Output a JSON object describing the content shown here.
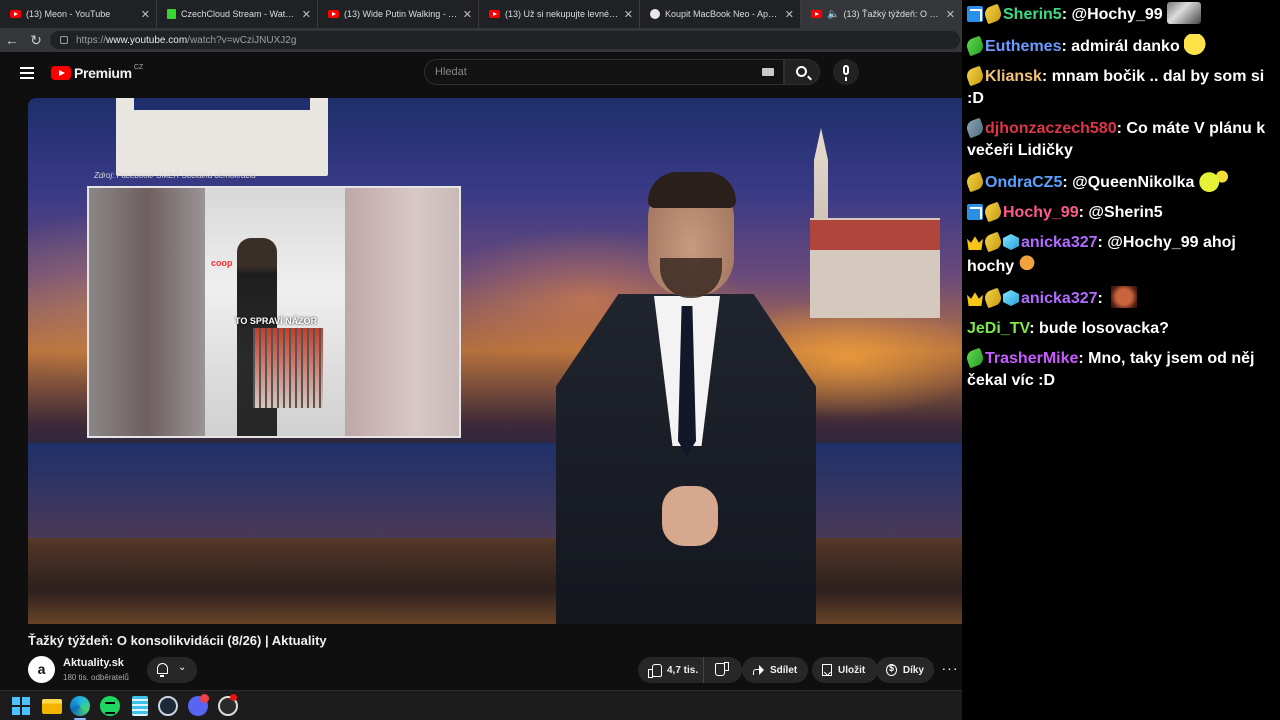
{
  "browser": {
    "tabs": [
      {
        "title": "(13) Meon - YouTube",
        "icon": "youtube-icon",
        "active": false
      },
      {
        "title": "CzechCloud Stream - Watch Live o",
        "icon": "kick-icon",
        "active": false
      },
      {
        "title": "(13) Wide Putin Walking - YouTube",
        "icon": "youtube-icon",
        "active": false
      },
      {
        "title": "(13) Už si nekupujte levné Window",
        "icon": "youtube-icon",
        "active": false
      },
      {
        "title": "Koupit MacBook Neo - Apple (CZ)",
        "icon": "apple-icon",
        "active": false
      },
      {
        "title": "(13) Ťažký týždeň: O konsolik",
        "icon": "youtube-icon",
        "active": true
      }
    ],
    "url_prefix": "https://",
    "url_host": "www.youtube.com",
    "url_path": "/watch?v=wCziJNUXJ2g"
  },
  "youtube": {
    "logo_text": "Premium",
    "country_code": "CZ",
    "search_placeholder": "Hledat"
  },
  "video": {
    "inset_source": "Zdroj: Facebook/ SMER Sociálna demokracia",
    "inset_store": "coop",
    "inset_caption": "TO SPRAVÍ NÁZOR",
    "title": "Ťažký týždeň: O konsolikvidácii (8/26) | Aktuality",
    "channel_avatar": "a",
    "channel_name": "Aktuality.sk",
    "channel_subs": "180 tis. odběratelů",
    "like_count": "4,7 tis.",
    "share_label": "Sdílet",
    "save_label": "Uložit",
    "thanks_label": "Díky",
    "more_label": "···"
  },
  "chat": [
    {
      "badges": [
        "prime",
        "gold"
      ],
      "user": "Sherin5",
      "color": "#3ddc84",
      "text": "@Hochy_99",
      "emote": "photo"
    },
    {
      "badges": [
        "green"
      ],
      "user": "Euthemes",
      "color": "#6b9bff",
      "text": "admirál danko",
      "emote": "yellow"
    },
    {
      "badges": [
        "gold"
      ],
      "user": "Kliansk",
      "color": "#f1c27d",
      "text": "mnam bočik .. dal by som si :D",
      "emote": ""
    },
    {
      "badges": [
        "gray"
      ],
      "user": "djhonzaczech580",
      "color": "#e0344a",
      "text": "Co máte V plánu k večeři Lidičky",
      "emote": ""
    },
    {
      "badges": [
        "gold"
      ],
      "user": "OndraCZ5",
      "color": "#5aa2ff",
      "text": "@QueenNikolka",
      "emote": "wave"
    },
    {
      "badges": [
        "prime",
        "gold"
      ],
      "user": "Hochy_99",
      "color": "#ff5a8c",
      "text": "@Sherin5",
      "emote": ""
    },
    {
      "badges": [
        "crown",
        "gold",
        "cube"
      ],
      "user": "anicka327",
      "color": "#b36bff",
      "text": "@Hochy_99 ahoj hochy",
      "emote": "girl"
    },
    {
      "badges": [
        "crown",
        "gold",
        "cube"
      ],
      "user": "anicka327",
      "color": "#b36bff",
      "text": "",
      "emote": "face"
    },
    {
      "badges": [],
      "user": "JeDi_TV",
      "color": "#7ee84a",
      "text": "bude losovacka?",
      "emote": ""
    },
    {
      "badges": [
        "green"
      ],
      "user": "TrasherMike",
      "color": "#c85aff",
      "text": "Mno, taky jsem od něj čekal víc :D",
      "emote": ""
    }
  ]
}
